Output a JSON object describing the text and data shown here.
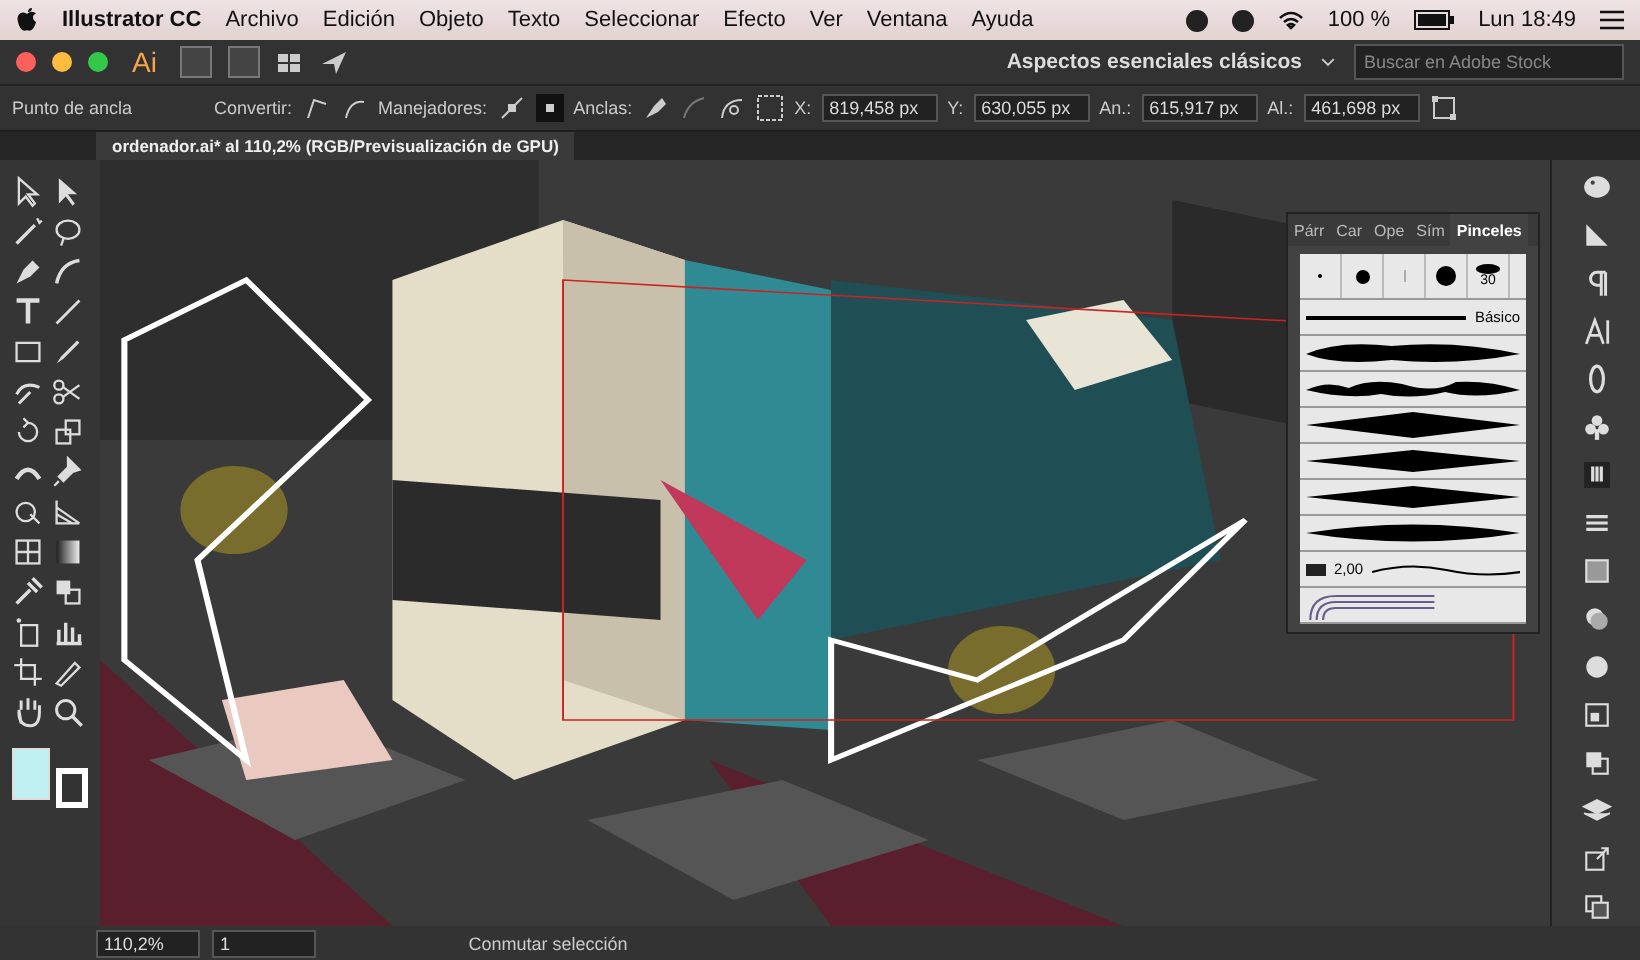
{
  "menu_bar": {
    "app": "Illustrator CC",
    "items": [
      "Archivo",
      "Edición",
      "Objeto",
      "Texto",
      "Seleccionar",
      "Efecto",
      "Ver",
      "Ventana",
      "Ayuda"
    ],
    "battery": "100 %",
    "clock": "Lun 18:49"
  },
  "app_bar": {
    "logo": "Ai",
    "workspace": "Aspectos esenciales clásicos",
    "search": {
      "placeholder": "Buscar en Adobe Stock"
    }
  },
  "control_bar": {
    "selection": "Punto de ancla",
    "convert_label": "Convertir:",
    "handles_label": "Manejadores:",
    "anchors_label": "Anclas:",
    "fields": [
      {
        "label": "X:",
        "value": "819,458 px"
      },
      {
        "label": "Y:",
        "value": "630,055 px"
      },
      {
        "label": "An.:",
        "value": "615,917 px"
      },
      {
        "label": "Al.:",
        "value": "461,698 px"
      }
    ]
  },
  "document_tab": {
    "title": "ordenador.ai* al 110,2% (RGB/Previsualización de GPU)"
  },
  "brushes_panel": {
    "tabs": [
      {
        "label": "Párr",
        "selected": false
      },
      {
        "label": "Car",
        "selected": false
      },
      {
        "label": "Ope",
        "selected": false
      },
      {
        "label": "Sím",
        "selected": false
      },
      {
        "label": "Pinceles",
        "selected": true
      }
    ],
    "tip_size": "30",
    "basic_label": "Básico",
    "stroke_weight": "2,00"
  },
  "status_bar": {
    "zoom": "110,2%",
    "artboard": "1",
    "status": "Conmutar selección"
  }
}
